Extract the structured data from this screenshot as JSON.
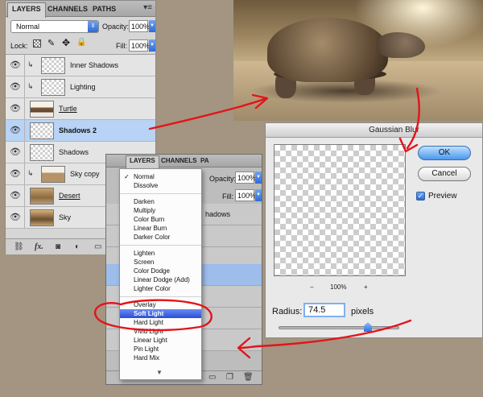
{
  "panel_back": {
    "tabs": [
      "LAYERS",
      "CHANNELS",
      "PATHS"
    ],
    "tab_menu": "▾≡",
    "blend_mode": "Normal",
    "opacity_label": "Opacity:",
    "opacity_value": "100%",
    "lock_label": "Lock:",
    "fill_label": "Fill:",
    "fill_value": "100%",
    "layers": [
      {
        "name": "Inner Shadows",
        "clipped": true
      },
      {
        "name": "Lighting",
        "clipped": true
      },
      {
        "name": "Turtle",
        "clipped": false,
        "underline": true
      },
      {
        "name": "Shadows 2",
        "clipped": false,
        "selected": true,
        "bold": true
      },
      {
        "name": "Shadows",
        "clipped": false
      },
      {
        "name": "Sky copy",
        "clipped": true
      },
      {
        "name": "Desert",
        "clipped": false,
        "underline": true
      },
      {
        "name": "Sky",
        "clipped": false
      }
    ]
  },
  "dialog": {
    "title": "Gaussian Blur",
    "ok": "OK",
    "cancel": "Cancel",
    "preview_label": "Preview",
    "preview_checked": true,
    "zoom_minus": "−",
    "zoom_value": "100%",
    "zoom_plus": "+",
    "radius_label": "Radius:",
    "radius_value": "74.5",
    "radius_unit": "pixels"
  },
  "panel_front": {
    "tabs": [
      "LAYERS",
      "CHANNELS",
      "PA"
    ],
    "opacity_label": "Opacity:",
    "opacity_value": "100%",
    "fill_label": "Fill:",
    "fill_value": "100%",
    "visible_layer_text": "hadows"
  },
  "blend_menu": {
    "selected": "Normal",
    "highlighted": "Soft Light",
    "groups": [
      [
        "Normal",
        "Dissolve"
      ],
      [
        "Darken",
        "Multiply",
        "Color Burn",
        "Linear Burn",
        "Darker Color"
      ],
      [
        "Lighten",
        "Screen",
        "Color Dodge",
        "Linear Dodge (Add)",
        "Lighter Color"
      ],
      [
        "Overlay",
        "Soft Light",
        "Hard Light",
        "Vivid Light",
        "Linear Light",
        "Pin Light",
        "Hard Mix"
      ]
    ],
    "more_arrow": "▼"
  },
  "colors": {
    "annotation_red": "#e3141b",
    "highlight_blue": "#2a4fd9",
    "selected_layer": "#b8d3f5",
    "background": "#a39581"
  }
}
